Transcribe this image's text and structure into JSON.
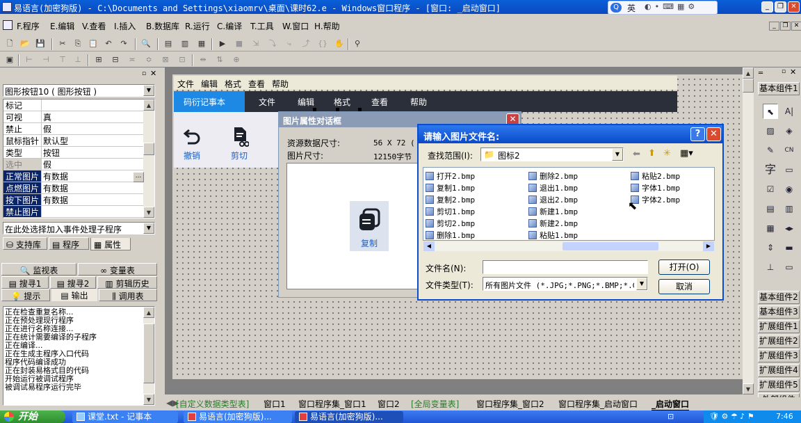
{
  "window": {
    "title": "易语言(加密狗版) - C:\\Documents and Settings\\xiaomrv\\桌面\\课时62.e - Windows窗口程序 - [窗口: _启动窗口]",
    "ime_label": "英"
  },
  "menu": [
    "F.程序",
    "E.编辑",
    "V.查看",
    "I.插入",
    "B.数据库",
    "R.运行",
    "C.编译",
    "T.工具",
    "W.窗口",
    "H.帮助"
  ],
  "property_panel": {
    "selector": "图形按钮10 ( 图形按钮 )",
    "rows": [
      {
        "k": "标记",
        "v": ""
      },
      {
        "k": "可视",
        "v": "真"
      },
      {
        "k": "禁止",
        "v": "假"
      },
      {
        "k": "鼠标指针",
        "v": "默认型"
      },
      {
        "k": "类型",
        "v": "按钮"
      },
      {
        "k": "选中",
        "v": "假"
      },
      {
        "k": "正常图片",
        "v": "有数据"
      },
      {
        "k": "点燃图片",
        "v": "有数据"
      },
      {
        "k": "按下图片",
        "v": "有数据"
      },
      {
        "k": "禁止图片",
        "v": ""
      }
    ],
    "event_placeholder": "在此处选择加入事件处理子程序",
    "tabs": [
      "支持库",
      "程序",
      "属性"
    ]
  },
  "output_panel": {
    "tabs_row1": [
      "监视表",
      "变量表"
    ],
    "tabs_row2": [
      "搜寻1",
      "搜寻2",
      "剪辑历史"
    ],
    "tabs_row3": [
      "提示",
      "输出",
      "调用表"
    ],
    "lines": [
      "正在检查重复名称...",
      "正在预处理现行程序",
      "正在进行名称连接...",
      "正在统计需要编译的子程序",
      "正在编译...",
      "正在生成主程序入口代码",
      "程序代码编译成功",
      "正在封装易格式目的代码",
      "开始运行被调试程序",
      "被调试易程序运行完毕"
    ]
  },
  "designer": {
    "form_menu": [
      "文件",
      "编辑",
      "格式",
      "查看",
      "帮助"
    ],
    "ribbon": [
      "码衍记事本",
      "文件",
      "编辑",
      "格式",
      "查看",
      "帮助"
    ],
    "tool_buttons": [
      {
        "label": "撤销"
      },
      {
        "label": "剪切"
      }
    ]
  },
  "pic_dialog": {
    "title": "图片属性对话框",
    "size_label": "资源数据尺寸:",
    "size_value": "56 X 72 (",
    "bytes_label": "图片尺寸:",
    "bytes_value": "12150字节",
    "preview_label": "复制"
  },
  "file_dialog": {
    "title": "请输入图片文件名:",
    "lookin_label": "查找范围(I):",
    "lookin_value": "图标2",
    "files": [
      "打开2.bmp",
      "复制1.bmp",
      "复制2.bmp",
      "剪切1.bmp",
      "剪切2.bmp",
      "删除1.bmp",
      "删除2.bmp",
      "退出1.bmp",
      "退出2.bmp",
      "新建1.bmp",
      "新建2.bmp",
      "粘贴1.bmp",
      "粘贴2.bmp",
      "字体1.bmp",
      "字体2.bmp"
    ],
    "filename_label": "文件名(N):",
    "filename_value": "",
    "filetype_label": "文件类型(T):",
    "filetype_value": "所有图片文件 (*.JPG;*.PNG;*.BMP;*.GI",
    "open_label": "打开(O)",
    "cancel_label": "取消"
  },
  "component_panel": {
    "groups_top": [
      "基本组件1"
    ],
    "groups_bottom": [
      "基本组件2",
      "基本组件3",
      "扩展组件1",
      "扩展组件2",
      "扩展组件3",
      "扩展组件4",
      "扩展组件5",
      "外部组件"
    ]
  },
  "bottom_tabs": [
    "[自定义数据类型表]",
    "窗口1",
    "窗口程序集_窗口1",
    "窗口2",
    "[全局变量表]",
    "窗口程序集_窗口2",
    "窗口程序集_启动窗口",
    "_启动窗口"
  ],
  "taskbar": {
    "start": "开始",
    "tasks": [
      "课堂.txt - 记事本",
      "易语言(加密狗版)...",
      "易语言(加密狗版)..."
    ],
    "time": "7:46"
  }
}
